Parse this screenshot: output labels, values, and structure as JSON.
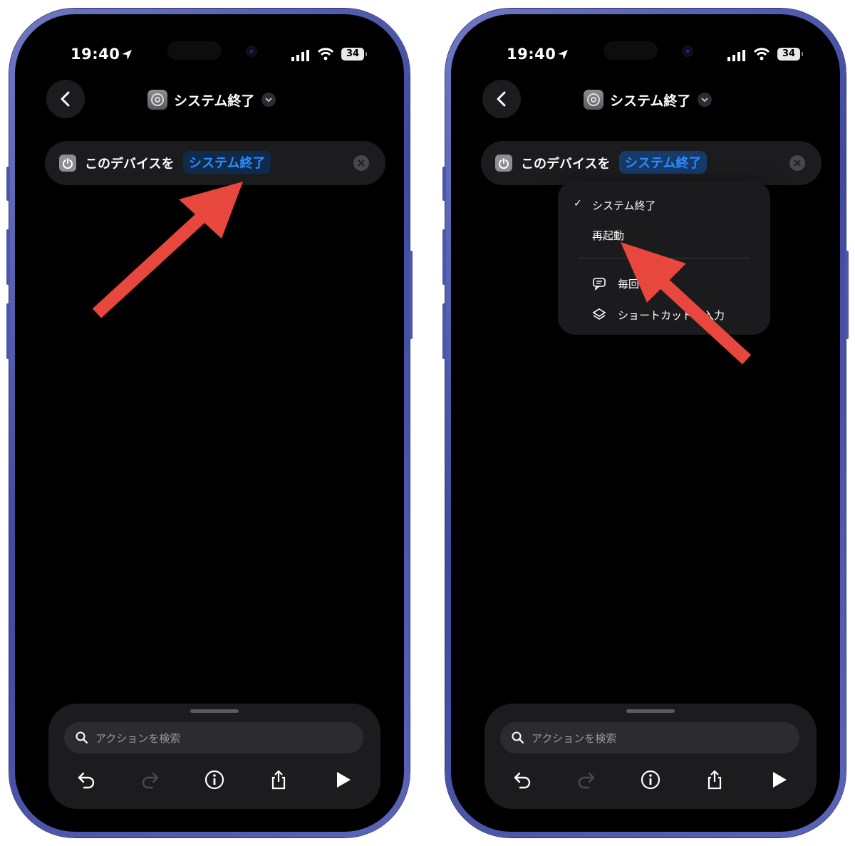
{
  "screens": [
    {
      "status": {
        "time": "19:40",
        "battery": "34"
      },
      "nav": {
        "title": "システム終了"
      },
      "action": {
        "text": "このデバイスを",
        "param": "システム終了"
      },
      "search": {
        "placeholder": "アクションを検索"
      }
    },
    {
      "status": {
        "time": "19:40",
        "battery": "34"
      },
      "nav": {
        "title": "システム終了"
      },
      "action": {
        "text": "このデバイスを",
        "param": "システム終了"
      },
      "menu": {
        "items": [
          {
            "label": "システム終了",
            "checked": true
          },
          {
            "label": "再起動",
            "checked": false
          },
          {
            "label": "毎回尋ねる",
            "icon": "speech-bubble-icon"
          },
          {
            "label": "ショートカットの入力",
            "icon": "layers-icon"
          }
        ]
      },
      "search": {
        "placeholder": "アクションを検索"
      }
    }
  ],
  "toolbar_icons": [
    "undo-icon",
    "redo-icon",
    "info-icon",
    "share-icon",
    "play-icon"
  ],
  "colors": {
    "frame": "#4f59ad",
    "accent": "#2f8cff",
    "annotation_arrow": "#e8473e"
  }
}
